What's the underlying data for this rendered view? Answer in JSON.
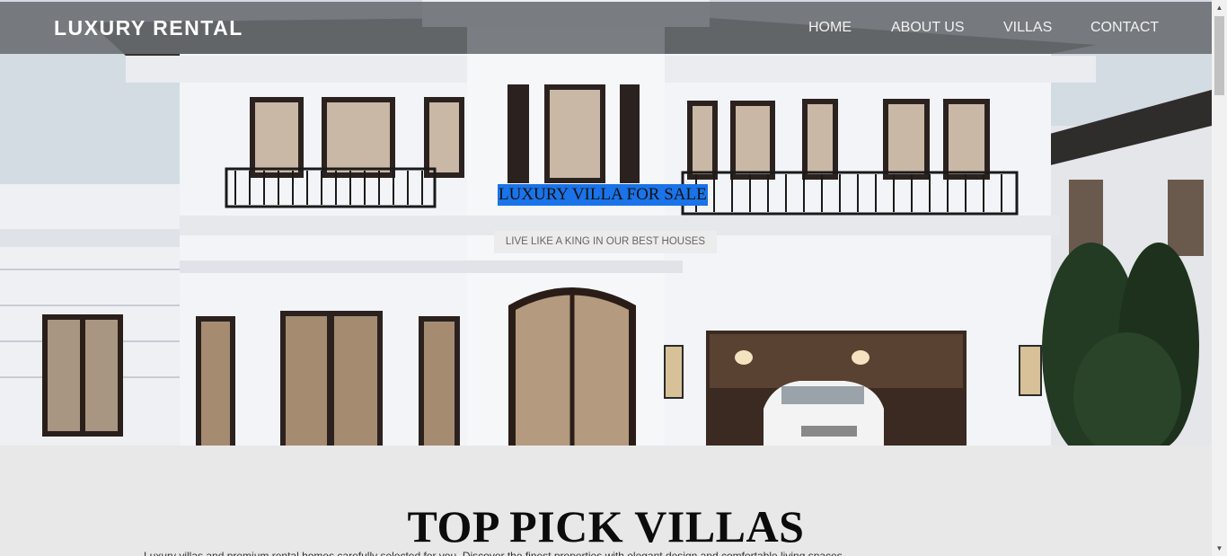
{
  "nav": {
    "brand": "LUXURY RENTAL",
    "links": [
      "HOME",
      "ABOUT US",
      "VILLAS",
      "CONTACT"
    ]
  },
  "hero": {
    "title": "LUXURY VILLA FOR SALE",
    "subtitle": "LIVE LIKE A KING IN OUR BEST HOUSES",
    "image_alt": "white-luxury-villa-photo"
  },
  "section": {
    "title": "TOP PICK VILLAS",
    "text": "Luxury villas and premium rental homes carefully selected for you. Discover the finest properties with elegant design and comfortable living spaces."
  },
  "colors": {
    "nav_bg": "#696c70",
    "highlight": "#1a73e8",
    "page_bg": "#e8e8e8"
  },
  "icons": {
    "scroll_up": "▲",
    "scroll_down": "▼"
  }
}
